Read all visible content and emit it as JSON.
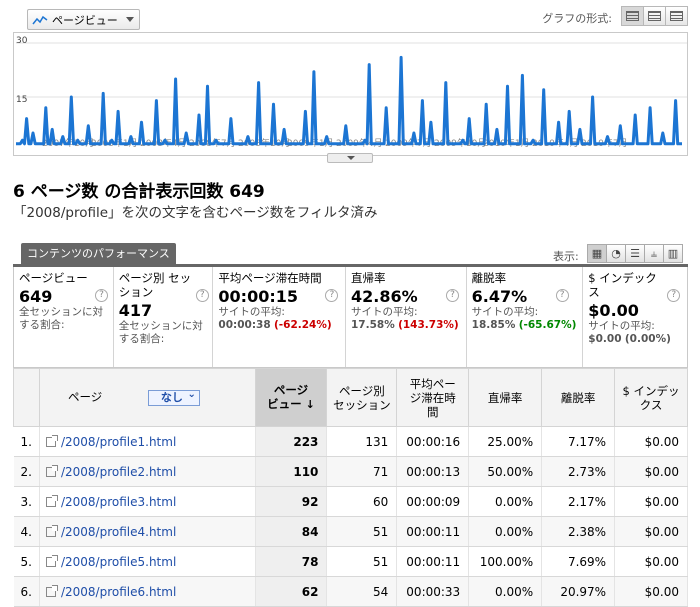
{
  "metric_select": {
    "label": "ページビュー"
  },
  "graph_format": {
    "label": "グラフの形式:"
  },
  "chart_data": {
    "type": "line",
    "series": [
      {
        "name": "ページビュー",
        "values": [
          2,
          2,
          2,
          3,
          2,
          9,
          2,
          2,
          5,
          2,
          2,
          2,
          2,
          2,
          12,
          2,
          2,
          6,
          2,
          2,
          2,
          2,
          4,
          2,
          2,
          2,
          15,
          2,
          2,
          3,
          2,
          2,
          2,
          2,
          7,
          2,
          2,
          2,
          2,
          2,
          2,
          16,
          2,
          2,
          2,
          3,
          2,
          2,
          11,
          2,
          2,
          2,
          2,
          2,
          4,
          2,
          2,
          2,
          2,
          8,
          2,
          2,
          2,
          2,
          2,
          2,
          14,
          2,
          2,
          2,
          3,
          2,
          2,
          2,
          2,
          20,
          2,
          2,
          2,
          2,
          5,
          2,
          2,
          2,
          2,
          2,
          10,
          2,
          2,
          2,
          18,
          2,
          2,
          2,
          3,
          2,
          2,
          2,
          2,
          2,
          2,
          9,
          2,
          2,
          2,
          2,
          2,
          2,
          2,
          4,
          2,
          2,
          2,
          2,
          19,
          2,
          2,
          2,
          2,
          2,
          2,
          13,
          2,
          2,
          2,
          2,
          6,
          2,
          2,
          2,
          2,
          2,
          2,
          2,
          2,
          2,
          11,
          2,
          2,
          2,
          22,
          2,
          2,
          2,
          2,
          2,
          4,
          2,
          2,
          2,
          2,
          2,
          2,
          2,
          2,
          7,
          2,
          2,
          2,
          2,
          2,
          2,
          2,
          2,
          3,
          2,
          24,
          2,
          2,
          2,
          2,
          2,
          2,
          2,
          12,
          2,
          2,
          2,
          2,
          2,
          2,
          26,
          2,
          2,
          2,
          2,
          2,
          5,
          2,
          2,
          2,
          14,
          2,
          2,
          2,
          8,
          2,
          2,
          2,
          2,
          2,
          2,
          19,
          2,
          2,
          2,
          2,
          2,
          2,
          2,
          3,
          2,
          2,
          9,
          2,
          2,
          2,
          2,
          2,
          2,
          2,
          13,
          2,
          2,
          2,
          2,
          6,
          2,
          2,
          2,
          2,
          18,
          2,
          2,
          2,
          2,
          2,
          2,
          21,
          2,
          2,
          2,
          2,
          3,
          2,
          2,
          2,
          2,
          17,
          2,
          2,
          2,
          2,
          2,
          2,
          8,
          2,
          2,
          2,
          2,
          11,
          2,
          2,
          2,
          2,
          6,
          2,
          2,
          2,
          2,
          2,
          15,
          2,
          2,
          2,
          2,
          2,
          2,
          4,
          2,
          2,
          2,
          2,
          2,
          7,
          2,
          2,
          2,
          2,
          2,
          2,
          10,
          2,
          2,
          2,
          2,
          2,
          2,
          12,
          2,
          2,
          2,
          2,
          2,
          5,
          2,
          2,
          2,
          2,
          2,
          14,
          2,
          2,
          2
        ]
      }
    ],
    "y_ticks": [
      "30",
      "15"
    ],
    "ylim": [
      0,
      30
    ],
    "x_tick_labels": [
      "2007年10月",
      "2008年1月",
      "2008年4月",
      "2008年7月",
      "2008年10月",
      "2009年1月",
      "2009年4月",
      "2009年7月",
      "2009年10月",
      "2010年1月",
      "2010年4月",
      "2010年7月"
    ],
    "grid": true,
    "color": "#1c75d3"
  },
  "heading": {
    "title": "6 ページ数 の合計表示回数 649",
    "filter": "「2008/profile」を次の文字を含むページ数をフィルタ済み"
  },
  "tab": {
    "label": "コンテンツのパフォーマンス"
  },
  "display_label": "表示:",
  "scorecards": [
    {
      "label": "ページビュー",
      "value": "649",
      "sub1": "全セッションに対",
      "sub2": "する割合:"
    },
    {
      "label": "ページ別 セッション",
      "value": "417",
      "sub1": "全セッションに対",
      "sub2": "する割合:"
    },
    {
      "label": "平均ページ滞在時間",
      "value": "00:00:15",
      "sub1": "サイトの平均:",
      "avg": "00:00:38",
      "delta": "(-62.24%)"
    },
    {
      "label": "直帰率",
      "value": "42.86%",
      "sub1": "サイトの平均:",
      "avg": "17.58%",
      "delta": "(143.73%)"
    },
    {
      "label": "離脱率",
      "value": "6.47%",
      "sub1": "サイトの平均:",
      "avg": "18.85%",
      "delta": "(-65.67%)"
    },
    {
      "label": "$ インデックス",
      "value": "$0.00",
      "sub1": "サイトの平均:",
      "avg": "$0.00",
      "delta": "(0.00%)"
    }
  ],
  "table": {
    "headers": {
      "page": "ページ",
      "none": "なし",
      "pv1": "ページ",
      "pv2": "ビュー",
      "sp1": "ページ別",
      "sp2": "セッション",
      "at1": "平均ペー",
      "at2": "ジ滞在時",
      "at3": "間",
      "bounce": "直帰率",
      "exit": "離脱率",
      "idx1": "$ インデッ",
      "idx2": "クス"
    },
    "rows": [
      {
        "n": "1.",
        "page": "/2008/profile1.html",
        "pv": "223",
        "ses": "131",
        "time": "00:00:16",
        "bounce": "25.00%",
        "exit": "7.17%",
        "idx": "$0.00"
      },
      {
        "n": "2.",
        "page": "/2008/profile2.html",
        "pv": "110",
        "ses": "71",
        "time": "00:00:13",
        "bounce": "50.00%",
        "exit": "2.73%",
        "idx": "$0.00"
      },
      {
        "n": "3.",
        "page": "/2008/profile3.html",
        "pv": "92",
        "ses": "60",
        "time": "00:00:09",
        "bounce": "0.00%",
        "exit": "2.17%",
        "idx": "$0.00"
      },
      {
        "n": "4.",
        "page": "/2008/profile4.html",
        "pv": "84",
        "ses": "51",
        "time": "00:00:11",
        "bounce": "0.00%",
        "exit": "2.38%",
        "idx": "$0.00"
      },
      {
        "n": "5.",
        "page": "/2008/profile5.html",
        "pv": "78",
        "ses": "51",
        "time": "00:00:11",
        "bounce": "100.00%",
        "exit": "7.69%",
        "idx": "$0.00"
      },
      {
        "n": "6.",
        "page": "/2008/profile6.html",
        "pv": "62",
        "ses": "54",
        "time": "00:00:33",
        "bounce": "0.00%",
        "exit": "20.97%",
        "idx": "$0.00"
      }
    ]
  }
}
